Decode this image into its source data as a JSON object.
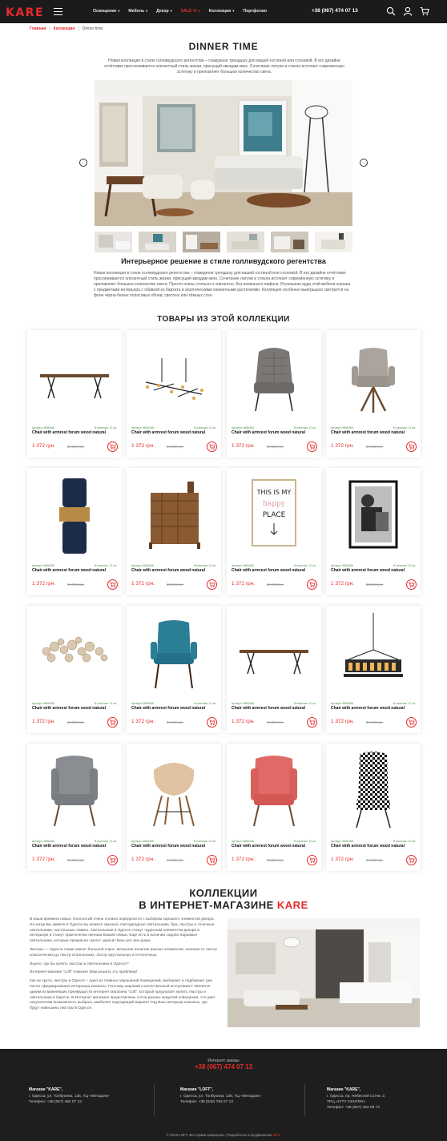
{
  "header": {
    "logo": "KARE",
    "nav": [
      {
        "label": "Освещение",
        "caret": "▾",
        "active": false
      },
      {
        "label": "Мебель",
        "caret": "▾",
        "active": false
      },
      {
        "label": "Декор",
        "caret": "▾",
        "active": false
      },
      {
        "label": "SALE %",
        "caret": "▾",
        "active": true
      },
      {
        "label": "Коллекции",
        "caret": "▾",
        "active": false
      },
      {
        "label": "Портфолио",
        "caret": "",
        "active": false
      }
    ],
    "phone": "+38 (067) 474 07 13",
    "icons": [
      "search-icon",
      "user-icon",
      "cart-icon"
    ]
  },
  "breadcrumb": {
    "home": "Главная",
    "section": "Коллекции",
    "current": "Dinner time",
    "separator": "|"
  },
  "page": {
    "title": "DINNER TIME",
    "intro": "Новая коллекция в стиле голливудского регентства – гламурное трендшоу для вашей гостиной или столовой. В его дизайне отчётливо прослеживается элегантный стиль жизни, присущий звездам кино. Сочетание латуни и стекла источает современную эстетику и преломляет большое количество света.",
    "slider": {
      "prev": "←",
      "next": "→",
      "thumb_count": 6
    },
    "subtitle": "Интерьерное решение в стиле голливудского регентства",
    "body": "Новая коллекция в стиле голливудского регентства – гламурное трендшоу для вашей гостиной или столовой. В его дизайне отчётливо прослеживается элегантный стиль жизни, присущий звездам кино. Сочетание латуни и стекла источает современную эстетику и преломляет большое количество света. Просто очень стильно и элегантно, без излишнего пафоса. Роскошная ауда этой мебели хороша с предметами интерьера с обивкой из бархата и экзотическими комнатными растениями. Коллекция особенно выигрышно смотрится на фоне чёрно-белых полосовых обоев, светлых или тёмных стен."
  },
  "products": {
    "title": "ТОВАРЫ ИЗ ЭТОЙ КОЛЛЕКЦИИ",
    "items": [
      {
        "img": "dining-table",
        "sku": "Артикул: 5656456",
        "stock": "В наличии: 12 шт.",
        "name": "Chair with armrest forum wood natural",
        "price": "1 372 грн.",
        "old": "24 818 грн."
      },
      {
        "img": "pendant-lamp",
        "sku": "Артикул: 5656456",
        "stock": "В наличии: 12 шт.",
        "name": "Chair with armrest forum wood natural",
        "price": "1 372 грн.",
        "old": "24 818 грн."
      },
      {
        "img": "grey-quilted-chair",
        "sku": "Артикул: 5656456",
        "stock": "В наличии: 12 шт.",
        "name": "Chair with armrest forum wood natural",
        "price": "1 372 грн.",
        "old": "24 818 грн."
      },
      {
        "img": "taupe-armchair",
        "sku": "Артикул: 5656456",
        "stock": "В наличии: 12 шт.",
        "name": "Chair with armrest forum wood natural",
        "price": "1 372 грн.",
        "old": "24 818 грн."
      },
      {
        "img": "vase",
        "sku": "Артикул: 5656456",
        "stock": "В наличии: 12 шт.",
        "name": "Chair with armrest forum wood natural",
        "price": "1 372 грн.",
        "old": "24 818 грн."
      },
      {
        "img": "wood-dresser",
        "sku": "Артикул: 5656456",
        "stock": "В наличии: 12 шт.",
        "name": "Chair with armrest forum wood natural",
        "price": "1 372 грн.",
        "old": "24 818 грн."
      },
      {
        "img": "happy-place-frame",
        "sku": "Артикул: 5656456",
        "stock": "В наличии: 12 шт.",
        "name": "Chair with armrest forum wood natural",
        "price": "1 372 грн.",
        "old": "24 818 грн."
      },
      {
        "img": "photo-frame",
        "sku": "Артикул: 5656456",
        "stock": "В наличии: 12 шт.",
        "name": "Chair with armrest forum wood natural",
        "price": "1 372 грн.",
        "old": "24 818 грн."
      },
      {
        "img": "crystal-chandelier",
        "sku": "Артикул: 5656456",
        "stock": "В наличии: 12 шт.",
        "name": "Chair with armrest forum wood natural",
        "price": "1 372 грн.",
        "old": "24 818 грн."
      },
      {
        "img": "blue-chair",
        "sku": "Артикул: 5656456",
        "stock": "В наличии: 12 шт.",
        "name": "Chair with armrest forum wood natural",
        "price": "1 372 грн.",
        "old": "24 818 грн."
      },
      {
        "img": "dining-table",
        "sku": "Артикул: 5656456",
        "stock": "В наличии: 12 шт.",
        "name": "Chair with armrest forum wood natural",
        "price": "1 372 грн.",
        "old": "24 818 грн."
      },
      {
        "img": "candle-chandelier",
        "sku": "Артикул: 5656456",
        "stock": "В наличии: 12 шт.",
        "name": "Chair with armrest forum wood natural",
        "price": "1 372 грн.",
        "old": "24 818 грн."
      },
      {
        "img": "grey-wing-chair",
        "sku": "Артикул: 5656456",
        "stock": "В наличии: 12 шт.",
        "name": "Chair with armrest forum wood natural",
        "price": "1 372 грн.",
        "old": "24 818 грн."
      },
      {
        "img": "beige-shell-chair",
        "sku": "Артикул: 5656456",
        "stock": "В наличии: 12 шт.",
        "name": "Chair with armrest forum wood natural",
        "price": "1 372 грн.",
        "old": "24 818 грн."
      },
      {
        "img": "coral-wing-chair",
        "sku": "Артикул: 5656456",
        "stock": "В наличии: 12 шт.",
        "name": "Chair with armrest forum wood natural",
        "price": "1 372 грн.",
        "old": "24 818 грн."
      },
      {
        "img": "houndstooth-chair",
        "sku": "Артикул: 5656456",
        "stock": "В наличии: 12 шт.",
        "name": "Chair with armrest forum wood natural",
        "price": "1 372 грн.",
        "old": "24 818 грн."
      }
    ]
  },
  "collections": {
    "title_line1": "КОЛЛЕКЦИИ",
    "title_line2": "В ИНТЕРНЕТ-МАГАЗИНЕ",
    "title_accent": "KARE",
    "paragraphs": [
      "В наши времена новых технологий очень сложно определится с выбором хорошего элементов декора. Но когда Вы живете в Одессе вы можете заказать светодиодные светильники, бра, люстры и точечные светильники, настольные лампы. Светильники в Одессе станут чудесным элементом декора в интерьере и станут практически личным Вашей семьи. Еще есть в наличии садово-парковые светильники, которые прекрасно смогут украсит Ваш уют вне дома.",
      "Люстры — Одесса также имеют большой спрос. Большое наличие разных элементов, начиная от люстр классических до люстр итальянских, люстр хрустальных и потолочных.",
      "Ищете, где бы купить люстры и светильники в Одессе?",
      "Интернет-магазин \"Loft\" поможет Вам решить эту проблему!",
      "Как не крути, люстры в Одессе – одно из главных украшений помещений, выбирают и подбирают уже после сформирования интерьера комнаты. Поэтому широкий и качественный ассортимент является одним из важнейших преимуществ интернет магазина \"Loft\", который предлагает купить люстры и светильники в Одессе. В Интернет магазине представлены сотни разных моделей освещения, что дает покупателям возможность выбрать наиболее подходящий вариант под Ваш интерьер комнаты, где будут навешаны люстры в Одессе."
    ]
  },
  "footer": {
    "order_label": "Интернет заказы",
    "phone": "+38 (067) 474 07 13",
    "stores": [
      {
        "title": "Магазин \"KARE\",",
        "address": "г. Одесса, ул. Толбухина, 135, ТЦ «Мегадом»",
        "phone": "Телефон: +38 (067) 484 07 13"
      },
      {
        "title": "Магазин \"LOFT\",",
        "address": "г. Одесса, ул. Толбухина, 135, ТЦ «Мегадом»",
        "phone": "Телефон: +38 (048) 793 07 13"
      },
      {
        "title": "Магазин \"KARE\",",
        "address": "г. Одесса, пр. Небесной сотни, 2,",
        "address2": "ТРЦ «CITY CENTER»",
        "phone": "Телефон: +38 (067) 484 09 74"
      }
    ],
    "copyright": "© 2019 LOFT. Все права защищены | Разработка и продвижение",
    "developer": "Ittelo"
  },
  "colors": {
    "accent": "#e52b2b",
    "header_bg": "#1b1b1b",
    "footer_bg": "#1e1e1e",
    "stock_green": "#4a8c4a"
  }
}
